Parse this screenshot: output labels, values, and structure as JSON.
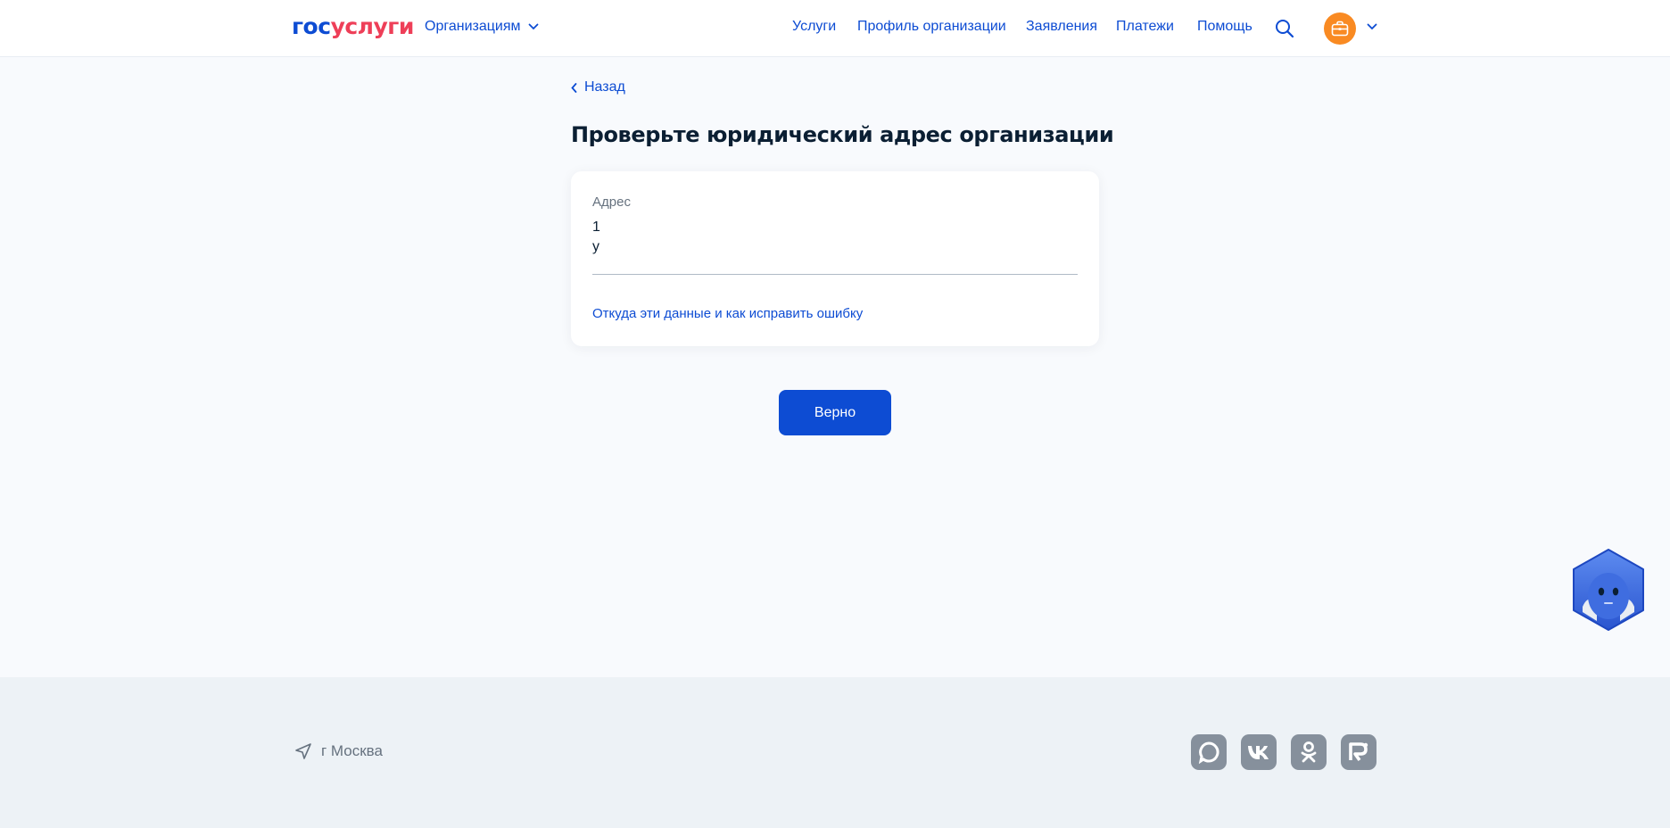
{
  "header": {
    "logo_part1": "гос",
    "logo_part2": "услуги",
    "org_switch_label": "Организациям",
    "nav": [
      {
        "label": "Услуги"
      },
      {
        "label": "Профиль организации"
      },
      {
        "label": "Заявления"
      },
      {
        "label": "Платежи"
      },
      {
        "label": "Помощь"
      }
    ],
    "icons": [
      "search-icon",
      "briefcase-icon",
      "chevron-down-icon"
    ]
  },
  "main": {
    "back_label": "Назад",
    "title": "Проверьте юридический адрес организации",
    "address_card": {
      "label": "Адрес",
      "value": "1\nу",
      "help_link": "Откуда эти данные и как исправить ошибку"
    },
    "confirm_label": "Верно"
  },
  "footer": {
    "location": "г Москва",
    "socials": [
      "max-icon",
      "vk-icon",
      "ok-icon",
      "rutube-icon"
    ]
  },
  "colors": {
    "accent": "#0d4cd3",
    "brand_red": "#ee3f58",
    "avatar": "#f98a22",
    "page_bg": "#f8fafd",
    "footer_bg": "#edf2f6",
    "social_bg": "#86909c"
  }
}
